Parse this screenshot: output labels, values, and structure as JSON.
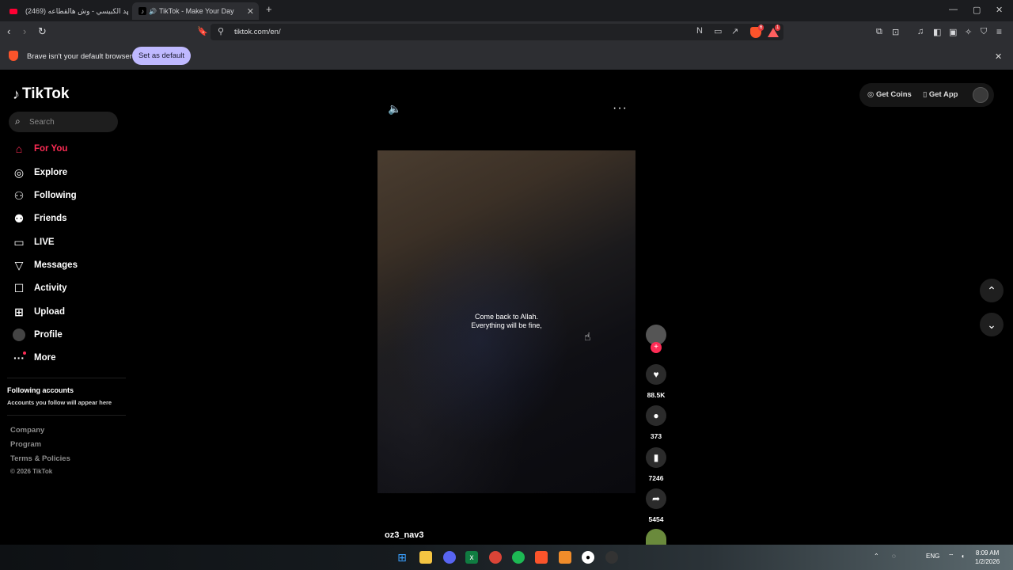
{
  "browser": {
    "tabs": [
      {
        "title": "(2469) فهد الكبيسي - وش هالقطاعه (l"
      },
      {
        "title": "TikTok - Make Your Day"
      }
    ],
    "new_tab": "+",
    "url": "tiktok.com/en/",
    "window_controls": {
      "minimize": "—",
      "maximize": "▢",
      "close": "✕"
    },
    "shield_badge": "6",
    "rewards_badge": "1",
    "infobar": {
      "message": "Brave isn't your default browser",
      "button": "Set as default",
      "close": "✕"
    }
  },
  "tiktok": {
    "logo": "TikTok",
    "search_placeholder": "Search",
    "nav": [
      {
        "label": "For You",
        "icon": "home-icon"
      },
      {
        "label": "Explore",
        "icon": "compass-icon"
      },
      {
        "label": "Following",
        "icon": "user-follow-icon"
      },
      {
        "label": "Friends",
        "icon": "friends-icon"
      },
      {
        "label": "LIVE",
        "icon": "live-icon"
      },
      {
        "label": "Messages",
        "icon": "messages-icon"
      },
      {
        "label": "Activity",
        "icon": "activity-icon"
      },
      {
        "label": "Upload",
        "icon": "upload-icon"
      },
      {
        "label": "Profile",
        "icon": "avatar"
      },
      {
        "label": "More",
        "icon": "more-icon"
      }
    ],
    "following_accounts_title": "Following accounts",
    "following_accounts_hint": "Accounts you follow will appear here",
    "footer": [
      "Company",
      "Program",
      "Terms & Policies",
      "© 2026 TikTok"
    ],
    "top": {
      "get_coins": "Get Coins",
      "get_app": "Get App"
    },
    "video": {
      "caption_line1": "Come back to Allah.",
      "caption_line2": "Everything will be fine,",
      "username": "oz3_nav3",
      "likes": "88.5K",
      "comments": "373",
      "saves": "7246",
      "shares": "5454"
    }
  },
  "taskbar": {
    "language": "ENG",
    "time": "8:09 AM",
    "date": "1/2/2026"
  },
  "colors": {
    "accent": "#fe2c55",
    "brave": "#fb542b",
    "set_default_btn": "#bfb9ff"
  }
}
